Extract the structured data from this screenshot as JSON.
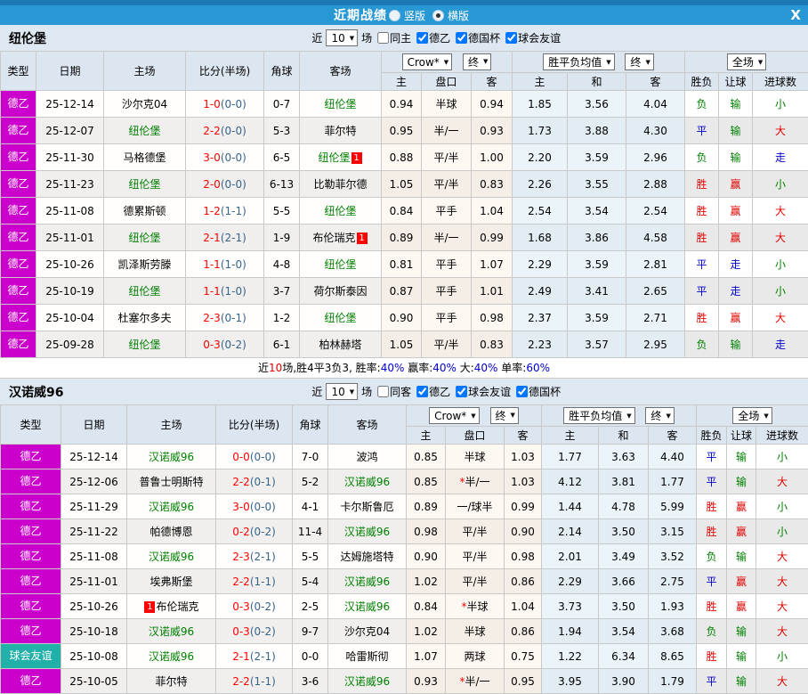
{
  "titlebar": {
    "title": "近期战绩",
    "vertical_label": "竖版",
    "horizontal_label": "横版",
    "selected_layout": "横版",
    "close_label": "X"
  },
  "columns": [
    "类型",
    "日期",
    "主场",
    "比分(半场)",
    "角球",
    "客场"
  ],
  "subcolumns": [
    "主",
    "盘口",
    "客",
    "主",
    "和",
    "客",
    "胜负",
    "让球",
    "进球数"
  ],
  "colors": {
    "title_blue": "#2798d4",
    "league_magenta": "#cc00cc",
    "friendly_teal": "#22b1a8",
    "team_green": "#008000",
    "score_red": "#ff0000",
    "half_blue": "#36648b",
    "win_red": "#e60000",
    "draw_blue": "#0000cc",
    "lose_green": "#008000"
  },
  "sections": [
    {
      "team": "纽伦堡",
      "filters": {
        "prefix": "近",
        "count": "10",
        "suffix": "场",
        "same_label": "同主",
        "same_checked": false,
        "leagues": [
          {
            "label": "德乙",
            "checked": true
          },
          {
            "label": "德国杯",
            "checked": true
          },
          {
            "label": "球会友谊",
            "checked": true
          }
        ]
      },
      "dropdowns": {
        "odds_source": "Crow*",
        "final_a": "终",
        "mean": "胜平负均值",
        "final_b": "终",
        "scope": "全场"
      },
      "rows": [
        {
          "type": "德乙",
          "tc": "league",
          "date": "25-12-14",
          "home": {
            "n": "沙尔克04"
          },
          "score": "1-0",
          "half": "(0-0)",
          "corner": "0-7",
          "away": {
            "n": "纽伦堡",
            "g": true
          },
          "o1": "0.94",
          "hc": "半球",
          "star": false,
          "o2": "0.94",
          "m1": "1.85",
          "m2": "3.56",
          "m3": "4.04",
          "r1": {
            "t": "负",
            "c": "g"
          },
          "r2": {
            "t": "输",
            "c": "g"
          },
          "r3": {
            "t": "小",
            "c": "g"
          }
        },
        {
          "type": "德乙",
          "tc": "league",
          "date": "25-12-07",
          "home": {
            "n": "纽伦堡",
            "g": true
          },
          "score": "2-2",
          "half": "(0-0)",
          "corner": "5-3",
          "away": {
            "n": "菲尔特"
          },
          "o1": "0.95",
          "hc": "半/一",
          "star": false,
          "o2": "0.93",
          "m1": "1.73",
          "m2": "3.88",
          "m3": "4.30",
          "r1": {
            "t": "平",
            "c": "b"
          },
          "r2": {
            "t": "输",
            "c": "g"
          },
          "r3": {
            "t": "大",
            "c": "r"
          }
        },
        {
          "type": "德乙",
          "tc": "league",
          "date": "25-11-30",
          "home": {
            "n": "马格德堡"
          },
          "score": "3-0",
          "half": "(0-0)",
          "corner": "6-5",
          "away": {
            "n": "纽伦堡",
            "g": true,
            "b": "1",
            "bp": "after"
          },
          "o1": "0.88",
          "hc": "平/半",
          "star": false,
          "o2": "1.00",
          "m1": "2.20",
          "m2": "3.59",
          "m3": "2.96",
          "r1": {
            "t": "负",
            "c": "g"
          },
          "r2": {
            "t": "输",
            "c": "g"
          },
          "r3": {
            "t": "走",
            "c": "b"
          }
        },
        {
          "type": "德乙",
          "tc": "league",
          "date": "25-11-23",
          "home": {
            "n": "纽伦堡",
            "g": true
          },
          "score": "2-0",
          "half": "(0-0)",
          "corner": "6-13",
          "away": {
            "n": "比勒菲尔德"
          },
          "o1": "1.05",
          "hc": "平/半",
          "star": false,
          "o2": "0.83",
          "m1": "2.26",
          "m2": "3.55",
          "m3": "2.88",
          "r1": {
            "t": "胜",
            "c": "r"
          },
          "r2": {
            "t": "赢",
            "c": "r"
          },
          "r3": {
            "t": "小",
            "c": "g"
          }
        },
        {
          "type": "德乙",
          "tc": "league",
          "date": "25-11-08",
          "home": {
            "n": "德累斯顿"
          },
          "score": "1-2",
          "half": "(1-1)",
          "corner": "5-5",
          "away": {
            "n": "纽伦堡",
            "g": true
          },
          "o1": "0.84",
          "hc": "平手",
          "star": false,
          "o2": "1.04",
          "m1": "2.54",
          "m2": "3.54",
          "m3": "2.54",
          "r1": {
            "t": "胜",
            "c": "r"
          },
          "r2": {
            "t": "赢",
            "c": "r"
          },
          "r3": {
            "t": "大",
            "c": "r"
          }
        },
        {
          "type": "德乙",
          "tc": "league",
          "date": "25-11-01",
          "home": {
            "n": "纽伦堡",
            "g": true
          },
          "score": "2-1",
          "half": "(2-1)",
          "corner": "1-9",
          "away": {
            "n": "布伦瑞克",
            "b": "1",
            "bp": "after"
          },
          "o1": "0.89",
          "hc": "半/一",
          "star": false,
          "o2": "0.99",
          "m1": "1.68",
          "m2": "3.86",
          "m3": "4.58",
          "r1": {
            "t": "胜",
            "c": "r"
          },
          "r2": {
            "t": "赢",
            "c": "r"
          },
          "r3": {
            "t": "大",
            "c": "r"
          }
        },
        {
          "type": "德乙",
          "tc": "league",
          "date": "25-10-26",
          "home": {
            "n": "凯泽斯劳滕"
          },
          "score": "1-1",
          "half": "(1-0)",
          "corner": "4-8",
          "away": {
            "n": "纽伦堡",
            "g": true
          },
          "o1": "0.81",
          "hc": "平手",
          "star": false,
          "o2": "1.07",
          "m1": "2.29",
          "m2": "3.59",
          "m3": "2.81",
          "r1": {
            "t": "平",
            "c": "b"
          },
          "r2": {
            "t": "走",
            "c": "b"
          },
          "r3": {
            "t": "小",
            "c": "g"
          }
        },
        {
          "type": "德乙",
          "tc": "league",
          "date": "25-10-19",
          "home": {
            "n": "纽伦堡",
            "g": true
          },
          "score": "1-1",
          "half": "(1-0)",
          "corner": "3-7",
          "away": {
            "n": "荷尔斯泰因"
          },
          "o1": "0.87",
          "hc": "平手",
          "star": false,
          "o2": "1.01",
          "m1": "2.49",
          "m2": "3.41",
          "m3": "2.65",
          "r1": {
            "t": "平",
            "c": "b"
          },
          "r2": {
            "t": "走",
            "c": "b"
          },
          "r3": {
            "t": "小",
            "c": "g"
          }
        },
        {
          "type": "德乙",
          "tc": "league",
          "date": "25-10-04",
          "home": {
            "n": "杜塞尔多夫"
          },
          "score": "2-3",
          "half": "(0-1)",
          "corner": "1-2",
          "away": {
            "n": "纽伦堡",
            "g": true
          },
          "o1": "0.90",
          "hc": "平手",
          "star": false,
          "o2": "0.98",
          "m1": "2.37",
          "m2": "3.59",
          "m3": "2.71",
          "r1": {
            "t": "胜",
            "c": "r"
          },
          "r2": {
            "t": "赢",
            "c": "r"
          },
          "r3": {
            "t": "大",
            "c": "r"
          }
        },
        {
          "type": "德乙",
          "tc": "league",
          "date": "25-09-28",
          "home": {
            "n": "纽伦堡",
            "g": true
          },
          "score": "0-3",
          "half": "(0-2)",
          "corner": "6-1",
          "away": {
            "n": "柏林赫塔"
          },
          "o1": "1.05",
          "hc": "平/半",
          "star": false,
          "o2": "0.83",
          "m1": "2.23",
          "m2": "3.57",
          "m3": "2.95",
          "r1": {
            "t": "负",
            "c": "g"
          },
          "r2": {
            "t": "输",
            "c": "g"
          },
          "r3": {
            "t": "走",
            "c": "b"
          }
        }
      ],
      "summary": [
        {
          "t": "近",
          "c": "k"
        },
        {
          "t": "10",
          "c": "r"
        },
        {
          "t": "场,胜4平3负3, 胜率:",
          "c": "k"
        },
        {
          "t": "40%",
          "c": "b"
        },
        {
          "t": " 赢率:",
          "c": "k"
        },
        {
          "t": "40%",
          "c": "b"
        },
        {
          "t": " 大:",
          "c": "k"
        },
        {
          "t": "40%",
          "c": "b"
        },
        {
          "t": " 单率:",
          "c": "k"
        },
        {
          "t": "60%",
          "c": "b"
        }
      ]
    },
    {
      "team": "汉诺威96",
      "filters": {
        "prefix": "近",
        "count": "10",
        "suffix": "场",
        "same_label": "同客",
        "same_checked": false,
        "leagues": [
          {
            "label": "德乙",
            "checked": true
          },
          {
            "label": "球会友谊",
            "checked": true
          },
          {
            "label": "德国杯",
            "checked": true
          }
        ]
      },
      "dropdowns": {
        "odds_source": "Crow*",
        "final_a": "终",
        "mean": "胜平负均值",
        "final_b": "终",
        "scope": "全场"
      },
      "rows": [
        {
          "type": "德乙",
          "tc": "league",
          "date": "25-12-14",
          "home": {
            "n": "汉诺威96",
            "g": true
          },
          "score": "0-0",
          "half": "(0-0)",
          "corner": "7-0",
          "away": {
            "n": "波鸿"
          },
          "o1": "0.85",
          "hc": "半球",
          "star": false,
          "o2": "1.03",
          "m1": "1.77",
          "m2": "3.63",
          "m3": "4.40",
          "r1": {
            "t": "平",
            "c": "b"
          },
          "r2": {
            "t": "输",
            "c": "g"
          },
          "r3": {
            "t": "小",
            "c": "g"
          }
        },
        {
          "type": "德乙",
          "tc": "league",
          "date": "25-12-06",
          "home": {
            "n": "普鲁士明斯特"
          },
          "score": "2-2",
          "half": "(0-1)",
          "corner": "5-2",
          "away": {
            "n": "汉诺威96",
            "g": true
          },
          "o1": "0.85",
          "hc": "半/一",
          "star": true,
          "o2": "1.03",
          "m1": "4.12",
          "m2": "3.81",
          "m3": "1.77",
          "r1": {
            "t": "平",
            "c": "b"
          },
          "r2": {
            "t": "输",
            "c": "g"
          },
          "r3": {
            "t": "大",
            "c": "r"
          }
        },
        {
          "type": "德乙",
          "tc": "league",
          "date": "25-11-29",
          "home": {
            "n": "汉诺威96",
            "g": true
          },
          "score": "3-0",
          "half": "(0-0)",
          "corner": "4-1",
          "away": {
            "n": "卡尔斯鲁厄"
          },
          "o1": "0.89",
          "hc": "一/球半",
          "star": false,
          "o2": "0.99",
          "m1": "1.44",
          "m2": "4.78",
          "m3": "5.99",
          "r1": {
            "t": "胜",
            "c": "r"
          },
          "r2": {
            "t": "赢",
            "c": "r"
          },
          "r3": {
            "t": "小",
            "c": "g"
          }
        },
        {
          "type": "德乙",
          "tc": "league",
          "date": "25-11-22",
          "home": {
            "n": "帕德博恩"
          },
          "score": "0-2",
          "half": "(0-2)",
          "corner": "11-4",
          "away": {
            "n": "汉诺威96",
            "g": true
          },
          "o1": "0.98",
          "hc": "平/半",
          "star": false,
          "o2": "0.90",
          "m1": "2.14",
          "m2": "3.50",
          "m3": "3.15",
          "r1": {
            "t": "胜",
            "c": "r"
          },
          "r2": {
            "t": "赢",
            "c": "r"
          },
          "r3": {
            "t": "小",
            "c": "g"
          }
        },
        {
          "type": "德乙",
          "tc": "league",
          "date": "25-11-08",
          "home": {
            "n": "汉诺威96",
            "g": true
          },
          "score": "2-3",
          "half": "(2-1)",
          "corner": "5-5",
          "away": {
            "n": "达姆施塔特"
          },
          "o1": "0.90",
          "hc": "平/半",
          "star": false,
          "o2": "0.98",
          "m1": "2.01",
          "m2": "3.49",
          "m3": "3.52",
          "r1": {
            "t": "负",
            "c": "g"
          },
          "r2": {
            "t": "输",
            "c": "g"
          },
          "r3": {
            "t": "大",
            "c": "r"
          }
        },
        {
          "type": "德乙",
          "tc": "league",
          "date": "25-11-01",
          "home": {
            "n": "埃弗斯堡"
          },
          "score": "2-2",
          "half": "(1-1)",
          "corner": "5-4",
          "away": {
            "n": "汉诺威96",
            "g": true
          },
          "o1": "1.02",
          "hc": "平/半",
          "star": false,
          "o2": "0.86",
          "m1": "2.29",
          "m2": "3.66",
          "m3": "2.75",
          "r1": {
            "t": "平",
            "c": "b"
          },
          "r2": {
            "t": "赢",
            "c": "r"
          },
          "r3": {
            "t": "大",
            "c": "r"
          }
        },
        {
          "type": "德乙",
          "tc": "league",
          "date": "25-10-26",
          "home": {
            "n": "布伦瑞克",
            "b": "1",
            "bp": "before"
          },
          "score": "0-3",
          "half": "(0-2)",
          "corner": "2-5",
          "away": {
            "n": "汉诺威96",
            "g": true
          },
          "o1": "0.84",
          "hc": "半球",
          "star": true,
          "o2": "1.04",
          "m1": "3.73",
          "m2": "3.50",
          "m3": "1.93",
          "r1": {
            "t": "胜",
            "c": "r"
          },
          "r2": {
            "t": "赢",
            "c": "r"
          },
          "r3": {
            "t": "大",
            "c": "r"
          }
        },
        {
          "type": "德乙",
          "tc": "league",
          "date": "25-10-18",
          "home": {
            "n": "汉诺威96",
            "g": true
          },
          "score": "0-3",
          "half": "(0-2)",
          "corner": "9-7",
          "away": {
            "n": "沙尔克04"
          },
          "o1": "1.02",
          "hc": "半球",
          "star": false,
          "o2": "0.86",
          "m1": "1.94",
          "m2": "3.54",
          "m3": "3.68",
          "r1": {
            "t": "负",
            "c": "g"
          },
          "r2": {
            "t": "输",
            "c": "g"
          },
          "r3": {
            "t": "大",
            "c": "r"
          }
        },
        {
          "type": "球会友谊",
          "tc": "friendly",
          "date": "25-10-08",
          "home": {
            "n": "汉诺威96",
            "g": true
          },
          "score": "2-1",
          "half": "(2-1)",
          "corner": "0-0",
          "away": {
            "n": "哈雷斯彻"
          },
          "o1": "1.07",
          "hc": "两球",
          "star": false,
          "o2": "0.75",
          "m1": "1.22",
          "m2": "6.34",
          "m3": "8.65",
          "r1": {
            "t": "胜",
            "c": "r"
          },
          "r2": {
            "t": "输",
            "c": "g"
          },
          "r3": {
            "t": "小",
            "c": "g"
          }
        },
        {
          "type": "德乙",
          "tc": "league",
          "date": "25-10-05",
          "home": {
            "n": "菲尔特"
          },
          "score": "2-2",
          "half": "(1-1)",
          "corner": "3-6",
          "away": {
            "n": "汉诺威96",
            "g": true
          },
          "o1": "0.93",
          "hc": "半/一",
          "star": true,
          "o2": "0.95",
          "m1": "3.95",
          "m2": "3.90",
          "m3": "1.79",
          "r1": {
            "t": "平",
            "c": "b"
          },
          "r2": {
            "t": "输",
            "c": "g"
          },
          "r3": {
            "t": "大",
            "c": "r"
          }
        }
      ],
      "summary": []
    }
  ]
}
